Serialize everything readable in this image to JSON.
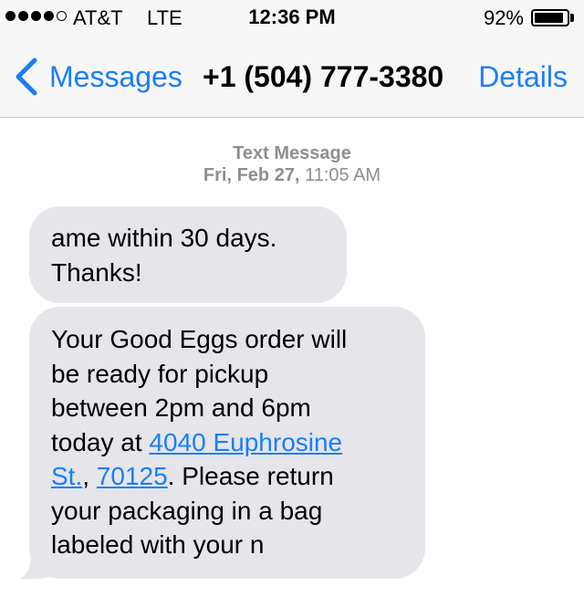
{
  "status_bar": {
    "signal_filled_dots": 4,
    "signal_total_dots": 5,
    "carrier": "AT&T",
    "network": "LTE",
    "time": "12:36 PM",
    "battery_percent_text": "92%",
    "battery_level": 0.92
  },
  "nav": {
    "back_label": "Messages",
    "back_icon": "chevron-left-icon",
    "title": "+1 (504) 777-3380",
    "details_label": "Details"
  },
  "conversation": {
    "message_type": "Text Message",
    "date_day": "Fri, Feb 27,",
    "date_time": "11:05 AM",
    "messages": [
      {
        "direction": "incoming",
        "text": "ame within 30 days.\nThanks!"
      },
      {
        "direction": "incoming",
        "text_before_link": "Your Good Eggs order will\nbe ready for pickup\nbetween 2pm and 6pm\ntoday at ",
        "address_link": "4040 Euphrosine\nSt.",
        "separator": ", ",
        "zip_link": "70125",
        "text_after_link": ". Please return\nyour packaging in a bag\nlabeled with your n"
      }
    ]
  },
  "colors": {
    "accent": "#1a7ef7",
    "bubble_incoming": "#e5e5ea",
    "timestamp": "#8e8e93",
    "header_bg": "#f7f7f8"
  }
}
